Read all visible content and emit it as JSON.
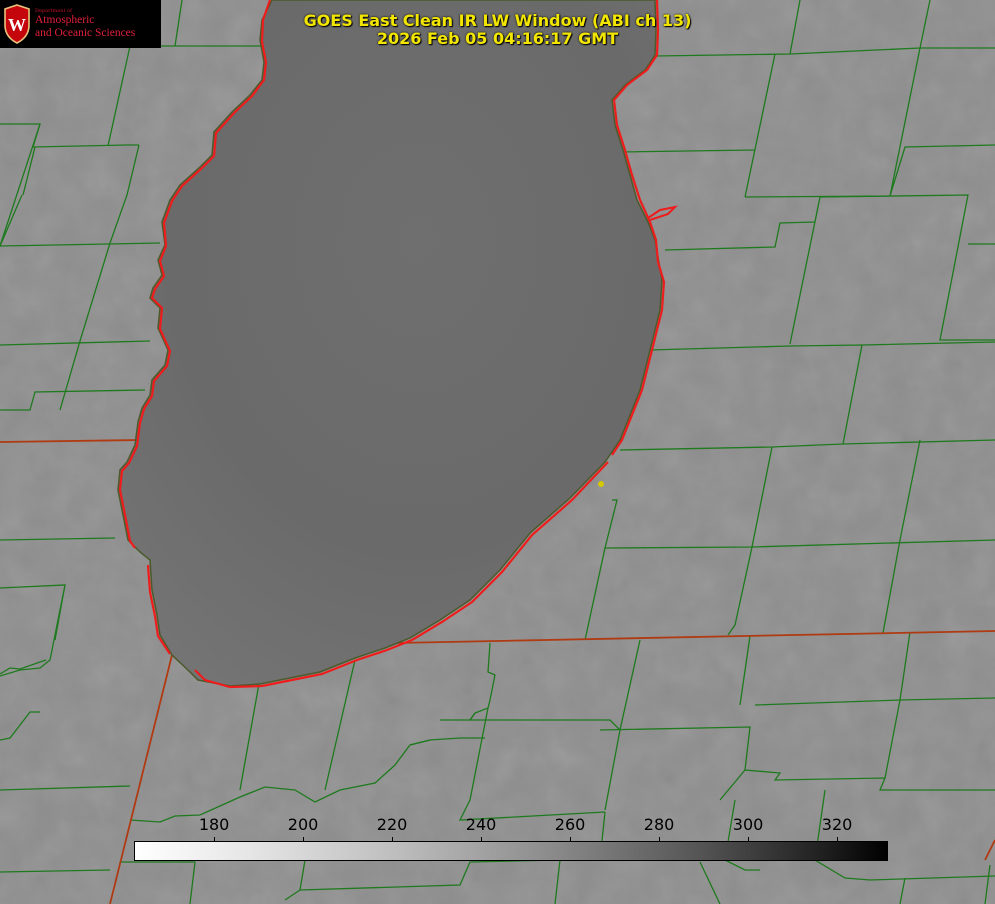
{
  "title": {
    "line1": "GOES East Clean IR LW Window (ABI ch 13)",
    "line2": "2026 Feb 05 04:16:17 GMT"
  },
  "logo": {
    "department_of": "Department of",
    "line1": "Atmospheric",
    "line2": "and Oceanic Sciences",
    "seal_letter": "W"
  },
  "colorbar": {
    "ticks": [
      "180",
      "200",
      "220",
      "240",
      "260",
      "280",
      "300",
      "320"
    ],
    "tick_values": [
      180,
      200,
      220,
      240,
      260,
      280,
      300,
      320
    ],
    "range": [
      162,
      331
    ],
    "colormap": "grayscale, white (cold) to black (warm)"
  },
  "colors": {
    "county_lines": "#1e7a1e",
    "state_lines": "#b03a12",
    "lake_outline": "#ee1c1c",
    "title_text": "#f2e600",
    "background_gray": "#8e8e8e",
    "lake_gray": "#6a6a6a"
  },
  "map": {
    "feature": "lake",
    "marker": "yellow-dot"
  }
}
